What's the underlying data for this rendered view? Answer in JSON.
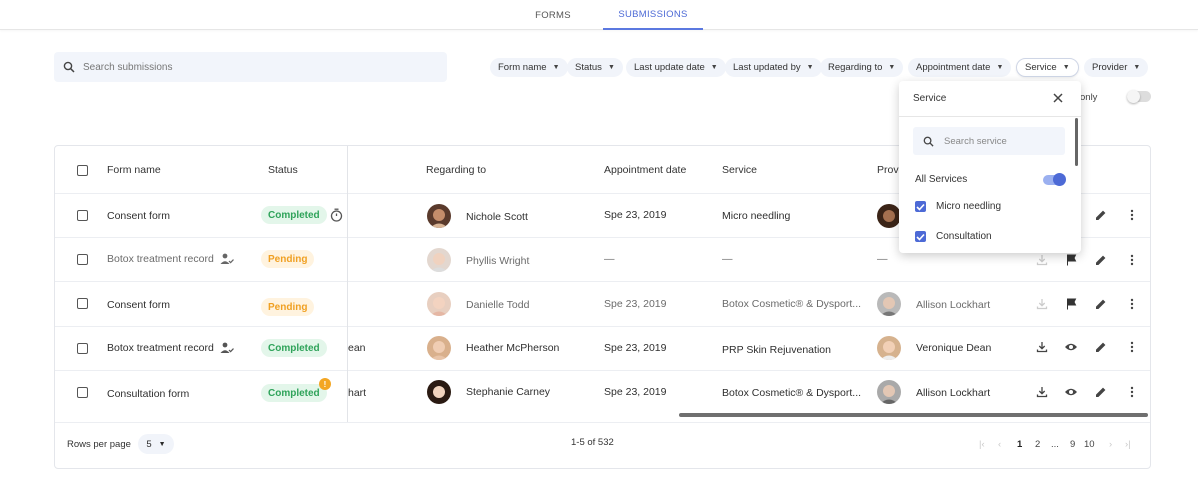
{
  "tabs": [
    {
      "label": "FORMS"
    },
    {
      "label": "SUBMISSIONS"
    }
  ],
  "search": {
    "placeholder": "Search submissions"
  },
  "filters": [
    {
      "label": "Form name"
    },
    {
      "label": "Status"
    },
    {
      "label": "Last update date"
    },
    {
      "label": "Last updated by"
    },
    {
      "label": "Regarding to"
    },
    {
      "label": "Appointment date"
    },
    {
      "label": "Service"
    },
    {
      "label": "Provider"
    }
  ],
  "only_toggle_label": "only",
  "table": {
    "headers": {
      "form_name": "Form name",
      "status": "Status",
      "regarding_to": "Regarding to",
      "appointment_date": "Appointment date",
      "service": "Service",
      "provider": "Provi"
    },
    "rows": [
      {
        "form_name": "Consent form",
        "status": "Completed",
        "partial": "",
        "regarding": "Nichole Scott",
        "date": "Spe 23, 2019",
        "service": "Micro needling",
        "provider": ""
      },
      {
        "form_name": "Botox treatment record",
        "status": "Pending",
        "partial": "",
        "regarding": "Phyllis Wright",
        "date": "—",
        "service": "—",
        "provider": "—"
      },
      {
        "form_name": "Consent form",
        "status": "Pending",
        "partial": "",
        "regarding": "Danielle Todd",
        "date": "Spe 23, 2019",
        "service": "Botox Cosmetic® & Dysport...",
        "provider": "Allison Lockhart"
      },
      {
        "form_name": "Botox treatment record",
        "status": "Completed",
        "partial": "ean",
        "regarding": "Heather McPherson",
        "date": "Spe 23, 2019",
        "service": "PRP Skin Rejuvenation",
        "provider": "Veronique Dean"
      },
      {
        "form_name": "Consultation form",
        "status": "Completed",
        "partial": "hart",
        "regarding": "Stephanie Carney",
        "date": "Spe 23, 2019",
        "service": "Botox Cosmetic® & Dysport...",
        "provider": "Allison Lockhart"
      }
    ]
  },
  "footer": {
    "rows_per_page_label": "Rows per page",
    "rows_per_page_value": "5",
    "range": "1-5 of 532",
    "pages": [
      "1",
      "2",
      "...",
      "9",
      "10"
    ]
  },
  "service_dropdown": {
    "title": "Service",
    "search_placeholder": "Search service",
    "all_label": "All Services",
    "all_enabled": true,
    "options": [
      {
        "label": "Micro needling",
        "checked": true
      },
      {
        "label": "Consultation",
        "checked": true
      }
    ]
  },
  "colors": {
    "accent": "#4d6ad6",
    "completed": "#2fa35a",
    "pending": "#f0a022"
  }
}
